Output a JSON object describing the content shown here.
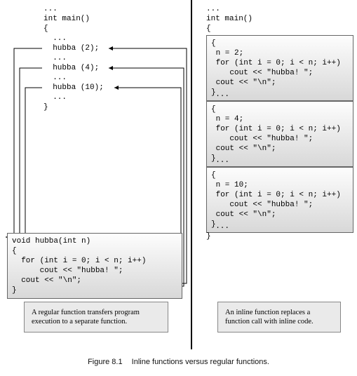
{
  "left": {
    "main_code": "...\nint main()\n{\n  ...\n  hubba (2);\n  ...\n  hubba (4);\n  ...\n  hubba (10);\n  ...\n}",
    "func_def": "void hubba(int n)\n{\n  for (int i = 0; i < n; i++)\n      cout << \"hubba! \";\n  cout << \"\\n\";\n}",
    "caption": "A regular function transfers program execution to a separate function."
  },
  "right": {
    "header": "...\nint main()\n{\n  ...",
    "inline_block_1": "{\n n = 2;\n for (int i = 0; i < n; i++)\n    cout << \"hubba! \";\n cout << \"\\n\";\n}",
    "sep1": "  ...",
    "inline_block_2": "{\n n = 4;\n for (int i = 0; i < n; i++)\n    cout << \"hubba! \";\n cout << \"\\n\";\n}",
    "sep2": "  ...",
    "inline_block_3": "{\n n = 10;\n for (int i = 0; i < n; i++)\n    cout << \"hubba! \";\n cout << \"\\n\";\n}",
    "trail": "  ...\n}",
    "caption": "An inline function replaces a function call with inline code."
  },
  "figure": {
    "number": "Figure 8.1",
    "text": "Inline functions versus regular functions."
  },
  "chart_data": {
    "type": "diagram",
    "title": "Inline functions versus regular functions",
    "description": "Left side shows a regular function call where main() calls hubba(2), hubba(4), hubba(10) and arrows show control transfer to the separate hubba(int n) definition and back. Right side shows the inline expansion where each call is replaced inline with the body of hubba using n=2, n=4, n=10.",
    "left_calls": [
      "hubba (2);",
      "hubba (4);",
      "hubba (10);"
    ],
    "right_expansions_n": [
      2,
      4,
      10
    ]
  }
}
